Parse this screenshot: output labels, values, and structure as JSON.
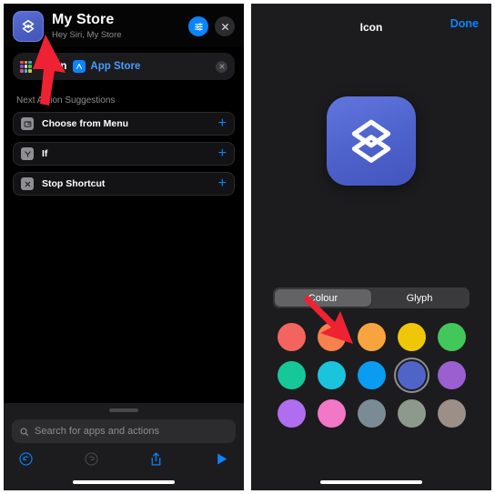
{
  "left": {
    "header": {
      "title": "My Store",
      "subtitle": "Hey Siri, My Store",
      "app_icon_name": "stacked-layers-glyph",
      "settings_button": "settings-sliders",
      "close_button": "close"
    },
    "action": {
      "verb": "Open",
      "target": "App Store",
      "remove_label": "remove-action"
    },
    "suggestions_title": "Next Action Suggestions",
    "suggestions": [
      {
        "label": "Choose from Menu",
        "icon": "menu-icon",
        "add": "+"
      },
      {
        "label": "If",
        "icon": "if-icon",
        "add": "+"
      },
      {
        "label": "Stop Shortcut",
        "icon": "stop-icon",
        "add": "+"
      }
    ],
    "search": {
      "placeholder": "Search for apps and actions",
      "icon": "search-icon"
    },
    "toolbar": [
      {
        "name": "undo-button",
        "glyph": "undo"
      },
      {
        "name": "redo-button",
        "glyph": "redo"
      },
      {
        "name": "share-button",
        "glyph": "share"
      },
      {
        "name": "run-button",
        "glyph": "play"
      }
    ]
  },
  "right": {
    "title": "Icon",
    "done_label": "Done",
    "preview_icon": "stacked-layers-glyph",
    "tabs": [
      {
        "label": "Colour",
        "selected": true
      },
      {
        "label": "Glyph",
        "selected": false
      }
    ],
    "colors": [
      {
        "hex": "#f4645f",
        "name": "red",
        "selected": false
      },
      {
        "hex": "#f6804e",
        "name": "orange",
        "selected": false
      },
      {
        "hex": "#f7a43f",
        "name": "amber",
        "selected": false
      },
      {
        "hex": "#f0c708",
        "name": "yellow",
        "selected": false
      },
      {
        "hex": "#42c75a",
        "name": "green",
        "selected": false
      },
      {
        "hex": "#16c79a",
        "name": "teal-green",
        "selected": false
      },
      {
        "hex": "#1bc4dd",
        "name": "cyan",
        "selected": false
      },
      {
        "hex": "#0b9bf0",
        "name": "blue",
        "selected": false
      },
      {
        "hex": "#5064c8",
        "name": "indigo",
        "selected": true
      },
      {
        "hex": "#9b5fd0",
        "name": "purple",
        "selected": false
      },
      {
        "hex": "#b06df0",
        "name": "violet",
        "selected": false
      },
      {
        "hex": "#f277c6",
        "name": "pink",
        "selected": false
      },
      {
        "hex": "#7b8b96",
        "name": "blue-grey",
        "selected": false
      },
      {
        "hex": "#8d998c",
        "name": "green-grey",
        "selected": false
      },
      {
        "hex": "#9c8f88",
        "name": "taupe",
        "selected": false
      }
    ]
  },
  "annotations": [
    {
      "name": "arrow-to-app-icon",
      "color": "#ee2233"
    },
    {
      "name": "arrow-to-colour-tab",
      "color": "#ee2233"
    }
  ]
}
